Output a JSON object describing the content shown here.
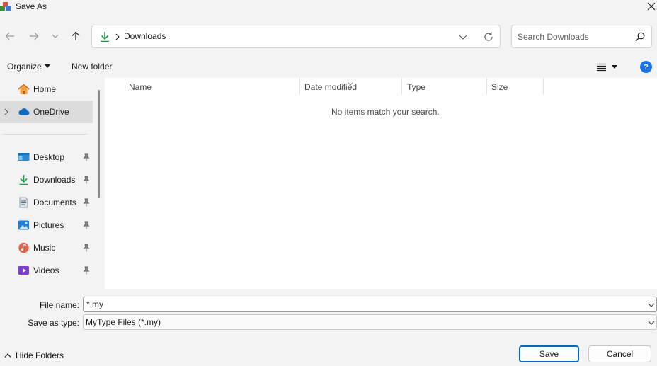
{
  "window": {
    "title": "Save As",
    "icons": {
      "app": "app-icon",
      "close": "close-icon"
    }
  },
  "nav": {
    "back_icon": "arrow-left-icon",
    "forward_icon": "arrow-right-icon",
    "recent_icon": "chevron-down-icon",
    "up_icon": "arrow-up-icon"
  },
  "address": {
    "location_icon": "download-icon",
    "segment": "Downloads",
    "dropdown_icon": "chevron-down-icon",
    "refresh_icon": "refresh-icon"
  },
  "search": {
    "placeholder": "Search Downloads",
    "icon": "search-icon"
  },
  "toolbar": {
    "organize_label": "Organize",
    "new_folder_label": "New folder",
    "view_icon": "list-view-icon",
    "help_label": "?"
  },
  "sidebar": {
    "items": [
      {
        "label": "Home",
        "icon": "home-icon",
        "pinned": false
      },
      {
        "label": "OneDrive",
        "icon": "cloud-icon",
        "pinned": false,
        "selected": true,
        "expandable": true
      },
      {
        "label": "Desktop",
        "icon": "desktop-icon",
        "pinned": true
      },
      {
        "label": "Downloads",
        "icon": "download-icon",
        "pinned": true
      },
      {
        "label": "Documents",
        "icon": "document-icon",
        "pinned": true
      },
      {
        "label": "Pictures",
        "icon": "picture-icon",
        "pinned": true
      },
      {
        "label": "Music",
        "icon": "music-icon",
        "pinned": true
      },
      {
        "label": "Videos",
        "icon": "video-icon",
        "pinned": true
      }
    ]
  },
  "content": {
    "columns": [
      "Name",
      "Date modified",
      "Type",
      "Size"
    ],
    "empty_message": "No items match your search."
  },
  "form": {
    "file_name_label": "File name:",
    "file_name_value": "*.my",
    "save_type_label": "Save as type:",
    "save_type_value": "MyType Files (*.my)"
  },
  "footer": {
    "hide_folders_label": "Hide Folders",
    "save_label": "Save",
    "cancel_label": "Cancel"
  },
  "colors": {
    "accent": "#0067c0",
    "download_green": "#1f9c4a",
    "onedrive_blue": "#0f6cbd",
    "help_blue": "#1a73e8"
  }
}
